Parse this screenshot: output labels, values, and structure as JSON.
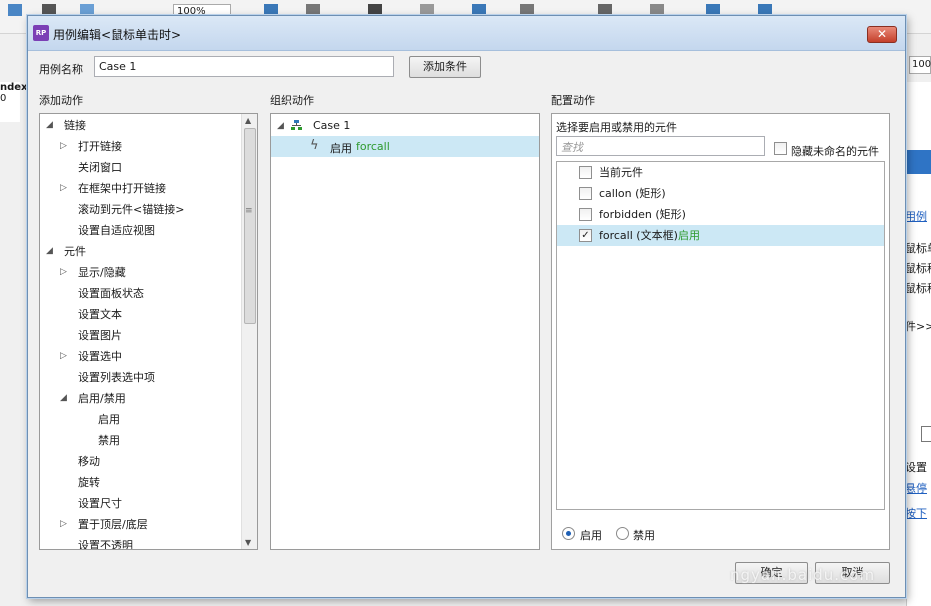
{
  "background": {
    "zoom_left": "100%",
    "zoom_right": "100",
    "left_label": "ndex",
    "left_sub": "0",
    "right_items": [
      "用例",
      "鼠标单",
      "鼠标移",
      "鼠标移",
      "件>>",
      "设置",
      "悬停",
      "按下"
    ]
  },
  "dialog": {
    "title": "用例编辑<鼠标单击时>",
    "close_label": "✕",
    "case_name_label": "用例名称",
    "case_name_value": "Case 1",
    "add_condition_label": "添加条件",
    "sections": {
      "add_actions": "添加动作",
      "organize_actions": "组织动作",
      "configure_actions": "配置动作"
    },
    "action_tree": [
      {
        "label": "链接",
        "level": 0,
        "expander": "expanded"
      },
      {
        "label": "打开链接",
        "level": 1,
        "expander": "collapsed"
      },
      {
        "label": "关闭窗口",
        "level": 1,
        "expander": "none"
      },
      {
        "label": "在框架中打开链接",
        "level": 1,
        "expander": "collapsed"
      },
      {
        "label": "滚动到元件<锚链接>",
        "level": 1,
        "expander": "none"
      },
      {
        "label": "设置自适应视图",
        "level": 1,
        "expander": "none"
      },
      {
        "label": "元件",
        "level": 0,
        "expander": "expanded"
      },
      {
        "label": "显示/隐藏",
        "level": 1,
        "expander": "collapsed"
      },
      {
        "label": "设置面板状态",
        "level": 1,
        "expander": "none"
      },
      {
        "label": "设置文本",
        "level": 1,
        "expander": "none"
      },
      {
        "label": "设置图片",
        "level": 1,
        "expander": "none"
      },
      {
        "label": "设置选中",
        "level": 1,
        "expander": "collapsed"
      },
      {
        "label": "设置列表选中项",
        "level": 1,
        "expander": "none"
      },
      {
        "label": "启用/禁用",
        "level": 1,
        "expander": "expanded"
      },
      {
        "label": "启用",
        "level": 2,
        "expander": "none"
      },
      {
        "label": "禁用",
        "level": 2,
        "expander": "none"
      },
      {
        "label": "移动",
        "level": 1,
        "expander": "none"
      },
      {
        "label": "旋转",
        "level": 1,
        "expander": "none"
      },
      {
        "label": "设置尺寸",
        "level": 1,
        "expander": "none"
      },
      {
        "label": "置于顶层/底层",
        "level": 1,
        "expander": "collapsed"
      },
      {
        "label": "设置不透明",
        "level": 1,
        "expander": "none"
      }
    ],
    "organize": {
      "case_label": "Case 1",
      "action_verb": "启用",
      "action_target": "forcall"
    },
    "configure": {
      "prompt": "选择要启用或禁用的元件",
      "search_placeholder": "查找",
      "hide_unnamed_label": "隐藏未命名的元件",
      "elements": [
        {
          "label": "当前元件",
          "checked": false,
          "state": ""
        },
        {
          "label": "callon (矩形)",
          "checked": false,
          "state": ""
        },
        {
          "label": "forbidden (矩形)",
          "checked": false,
          "state": ""
        },
        {
          "label": "forcall (文本框)",
          "checked": true,
          "state": "启用"
        }
      ],
      "radio_enable_label": "启用",
      "radio_disable_label": "禁用",
      "selected_radio": "enable"
    },
    "ok_label": "确定",
    "cancel_label": "取消"
  },
  "watermark": "ngyan.baidu.com"
}
